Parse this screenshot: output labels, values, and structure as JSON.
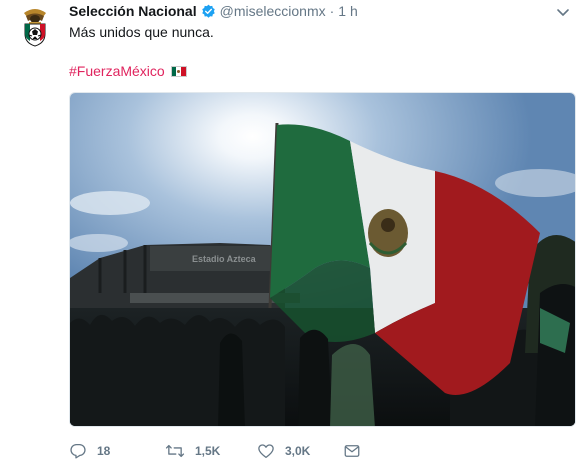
{
  "tweet": {
    "display_name": "Selección Nacional",
    "handle": "@miseleccionmx",
    "separator": "·",
    "time": "1 h",
    "text": "Más unidos que nunca.",
    "hashtag": "#FuerzaMéxico",
    "emoji": "mexico-flag-emoji",
    "image_sign_text": "Estadio Azteca"
  },
  "actions": {
    "replies": "18",
    "retweets": "1,5K",
    "likes": "3,0K"
  },
  "colors": {
    "text": "#14171a",
    "secondary": "#657786",
    "hashtag": "#e0245e",
    "verified": "#1da1f2",
    "flag_green": "#006847",
    "flag_white": "#ffffff",
    "flag_red": "#ce1126"
  },
  "icons": [
    "verified-badge-icon",
    "chevron-down-icon",
    "reply-icon",
    "retweet-icon",
    "like-icon",
    "direct-message-icon"
  ]
}
